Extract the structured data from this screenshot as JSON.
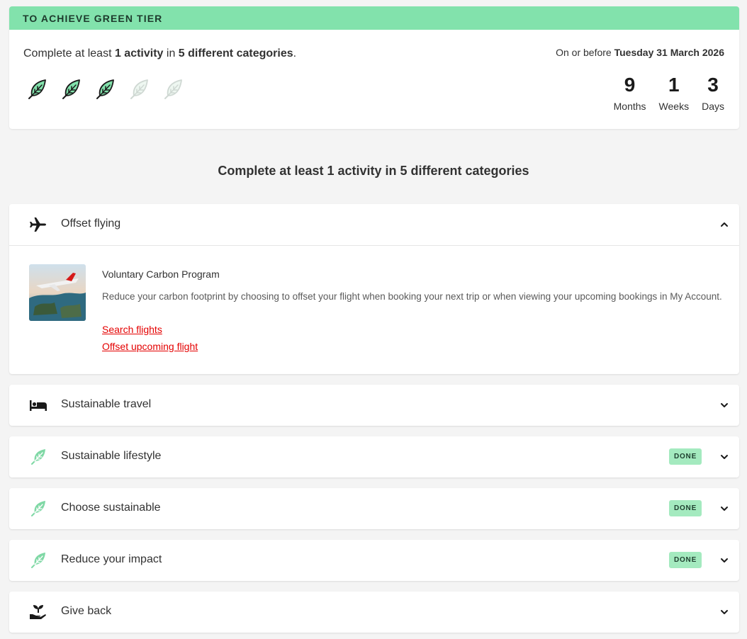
{
  "tier": {
    "banner": "TO ACHIEVE GREEN TIER",
    "req_prefix": "Complete at least ",
    "req_count": "1 activity",
    "req_mid": " in ",
    "req_categories": "5 different categories",
    "req_suffix": ".",
    "leaves": [
      {
        "icon": "leaf-icon",
        "state": "complete"
      },
      {
        "icon": "leaf-icon",
        "state": "complete"
      },
      {
        "icon": "leaf-icon",
        "state": "complete"
      },
      {
        "icon": "leaf-icon",
        "state": "incomplete"
      },
      {
        "icon": "leaf-icon",
        "state": "incomplete"
      }
    ],
    "deadline_prefix": "On or before ",
    "deadline_date": "Tuesday 31 March 2026",
    "countdown": [
      {
        "value": "9",
        "label": "Months"
      },
      {
        "value": "1",
        "label": "Weeks"
      },
      {
        "value": "3",
        "label": "Days"
      }
    ]
  },
  "section_title": "Complete at least 1 activity in 5 different categories",
  "done_label": "DONE",
  "categories": [
    {
      "label": "Offset flying",
      "icon": "airplane-icon",
      "done": false,
      "expanded": true
    },
    {
      "label": "Sustainable travel",
      "icon": "bed-icon",
      "done": false,
      "expanded": false
    },
    {
      "label": "Sustainable lifestyle",
      "icon": "leaf-icon",
      "done": true,
      "expanded": false
    },
    {
      "label": "Choose sustainable",
      "icon": "leaf-icon",
      "done": true,
      "expanded": false
    },
    {
      "label": "Reduce your impact",
      "icon": "leaf-icon",
      "done": true,
      "expanded": false
    },
    {
      "label": "Give back",
      "icon": "hand-plant-icon",
      "done": false,
      "expanded": false
    }
  ],
  "offset_program": {
    "title": "Voluntary Carbon Program",
    "description": "Reduce your carbon footprint by choosing to offset your flight when booking your next trip or when viewing your upcoming bookings in My Account.",
    "link_search": "Search flights",
    "link_offset": "Offset upcoming flight"
  },
  "colors": {
    "banner": "#82e2ac",
    "done_badge": "#a4eabf",
    "leaf_fill": "#82e2ac",
    "link": "#e40000"
  }
}
